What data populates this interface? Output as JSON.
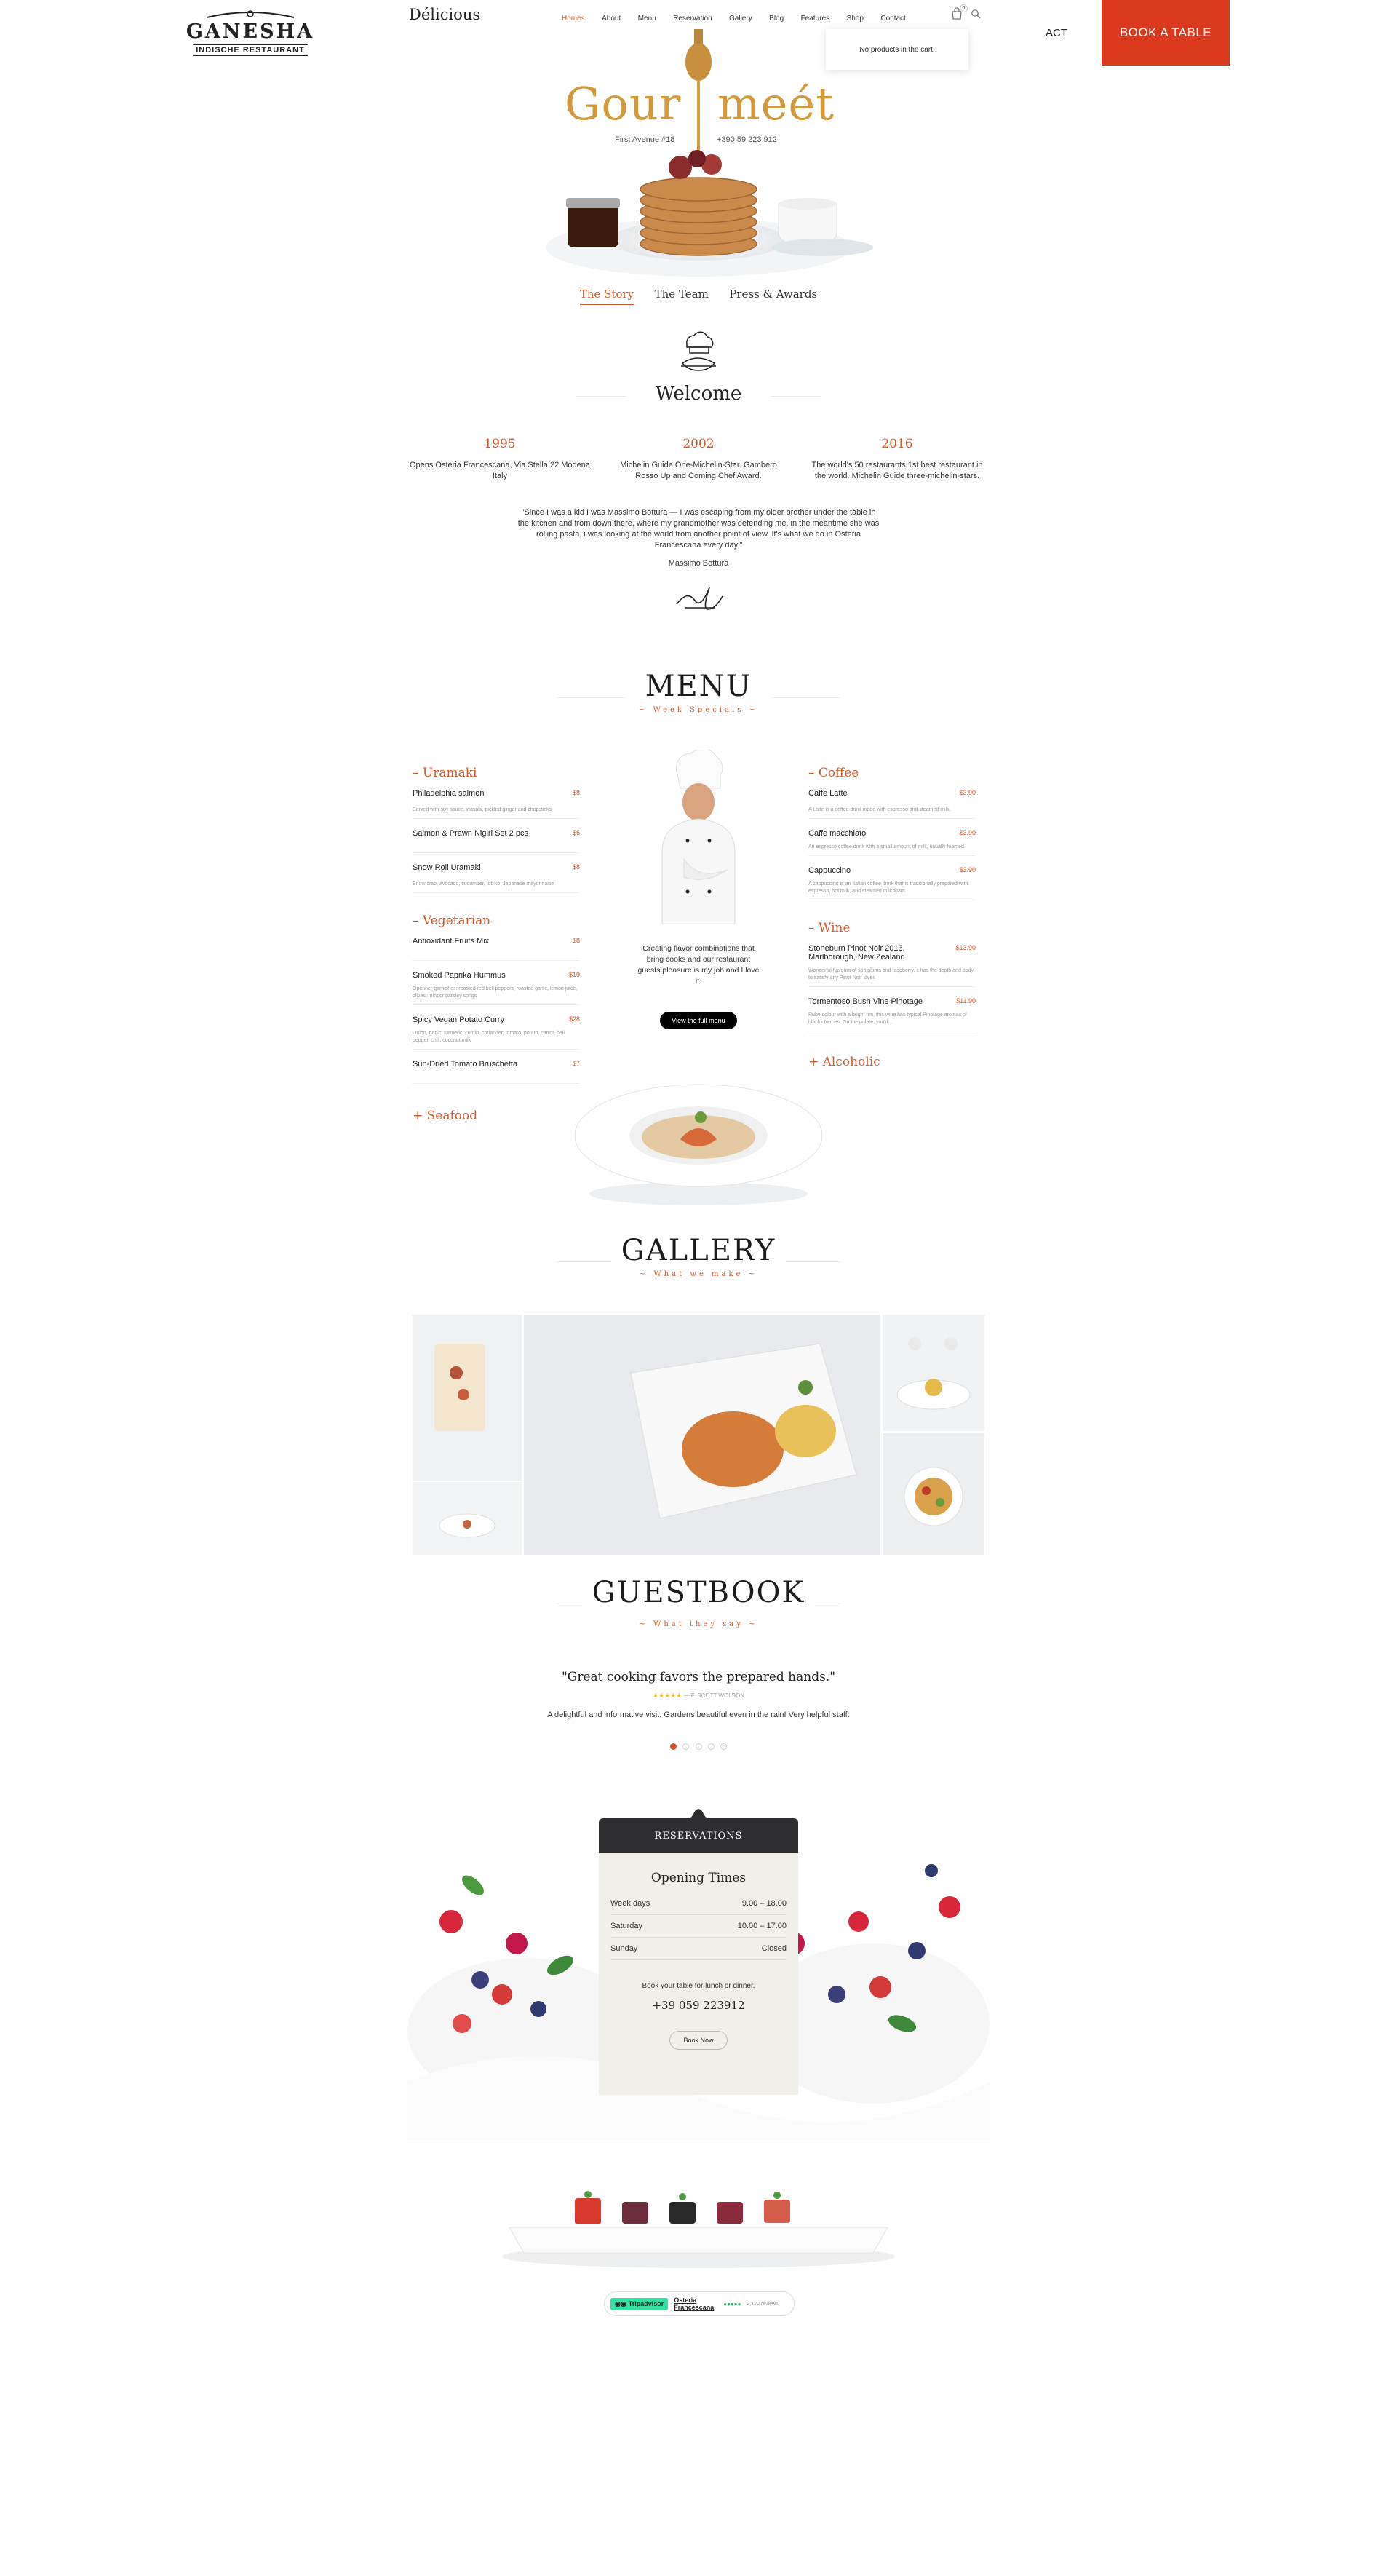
{
  "header": {
    "logo_title": "GANESHA",
    "logo_subtitle": "INDISCHE RESTAURANT",
    "brand_script": "Délicious",
    "nav": [
      "Homes",
      "About",
      "Menu",
      "Reservation",
      "Gallery",
      "Blog",
      "Features",
      "Shop",
      "Contact"
    ],
    "cart_count": "0",
    "cart_popup": "No products in the cart.",
    "partial_link": "ACT",
    "book_button": "BOOK A TABLE"
  },
  "hero": {
    "title_left": "Gour",
    "title_right": "meét",
    "address": "First Avenue #18",
    "phone": "+390 59 223 912"
  },
  "tabs": [
    "The Story",
    "The Team",
    "Press & Awards"
  ],
  "welcome": {
    "title": "Welcome",
    "timeline": [
      {
        "year": "1995",
        "text": "Opens Osteria Francescana, Via Stella 22 Modena Italy"
      },
      {
        "year": "2002",
        "text": "Michelin Guide One-Michelin-Star. Gambero Rosso Up and Coming Chef Award."
      },
      {
        "year": "2016",
        "text": "The world's 50 restaurants 1st best restaurant in the world. Michelin Guide three-michelin-stars."
      }
    ],
    "quote": "\"Since I was a kid I was Massimo Bottura — I was escaping from my older brother under the table in the kitchen and from down there, where my grandmother was defending me, in the meantime she was rolling pasta, i was looking at the world from another point of view. It's what we do in Osteria Francescana every day.\"",
    "author": "Massimo Bottura"
  },
  "menu": {
    "title": "MENU",
    "subtitle": "~ Week Specials ~",
    "left": [
      {
        "category": "– Uramaki",
        "items": [
          {
            "name": "Philadelphia salmon",
            "price": "$8",
            "desc": "Served with soy sauce, wasabi, pickled ginger and chopsticks"
          },
          {
            "name": "Salmon & Prawn Nigiri Set 2 pcs",
            "price": "$6",
            "desc": ""
          },
          {
            "name": "Snow Roll Uramaki",
            "price": "$8",
            "desc": "Snow crab, avocado, cucumber, tobiko, Japanese mayonnaise"
          }
        ]
      },
      {
        "category": "– Vegetarian",
        "items": [
          {
            "name": "Antioxidant Fruits Mix",
            "price": "$8",
            "desc": ""
          },
          {
            "name": "Smoked Paprika Hummus",
            "price": "$19",
            "desc": "Openner garnishes: roasted red bell peppers, roasted garlic, lemon juice, olives, mint or parsley sprigs"
          },
          {
            "name": "Spicy Vegan Potato Curry",
            "price": "$28",
            "desc": "Onion, garlic, turmeric, cumin, coriander, tomato, potato, carrot, bell pepper, chili, coconut milk"
          },
          {
            "name": "Sun-Dried Tomato Bruschetta",
            "price": "$7",
            "desc": ""
          }
        ]
      },
      {
        "category": "+ Seafood",
        "items": []
      }
    ],
    "right": [
      {
        "category": "– Coffee",
        "items": [
          {
            "name": "Caffe Latte",
            "price": "$3.90",
            "desc": "A Latte is a coffee drink made with espresso and steamed milk."
          },
          {
            "name": "Caffe macchiato",
            "price": "$3.90",
            "desc": "An espresso coffee drink with a small amount of milk, usually foamed."
          },
          {
            "name": "Cappuccino",
            "price": "$3.90",
            "desc": "A cappuccino is an Italian coffee drink that is traditionally prepared with espresso, hot milk, and steamed milk foam."
          }
        ]
      },
      {
        "category": "– Wine",
        "items": [
          {
            "name": "Stoneburn Pinot Noir 2013, Marlborough, New Zealand",
            "price": "$13.90",
            "desc": "Wonderful flavours of soft plums and raspberry, it has the depth and body to satisfy any Pinot Noir lover."
          },
          {
            "name": "Tormentoso Bush Vine Pinotage",
            "price": "$11.90",
            "desc": "Ruby-colour with a bright rim, this wine has typical Pinotage aromas of black cherries. On the palate, you'd..."
          }
        ]
      },
      {
        "category": "+ Alcoholic",
        "items": []
      }
    ],
    "chef_text": "Creating flavor combinations that bring cooks and our restaurant guests pleasure is my job and I love it.",
    "cta": "View the full menu"
  },
  "gallery": {
    "title": "GALLERY",
    "subtitle": "~ What we make ~"
  },
  "guestbook": {
    "title": "GUESTBOOK",
    "subtitle": "~ What they say ~",
    "quote": "\"Great cooking favors the prepared hands.\"",
    "stars": "★★★★★",
    "reviewer": "— F. SCOTT WOLSON",
    "text": "A delightful and informative visit. Gardens beautiful even in the rain! Very helpful staff.",
    "dots": 5,
    "active_dot": 0
  },
  "reservation": {
    "header": "RESERVATIONS",
    "title": "Opening Times",
    "rows": [
      {
        "day": "Week days",
        "hours": "9.00 – 18.00"
      },
      {
        "day": "Saturday",
        "hours": "10.00 – 17.00"
      },
      {
        "day": "Sunday",
        "hours": "Closed"
      }
    ],
    "note": "Book your table for lunch or dinner.",
    "phone": "+39 059 223912",
    "button": "Book Now"
  },
  "tripadvisor": {
    "brand": "Tripadvisor",
    "name": "Osteria Francescana",
    "reviews": "2,120 reviews"
  },
  "colors": {
    "accent": "#d3592a",
    "book_button": "#d93a1e",
    "hero_gold": "#d39a3d"
  }
}
